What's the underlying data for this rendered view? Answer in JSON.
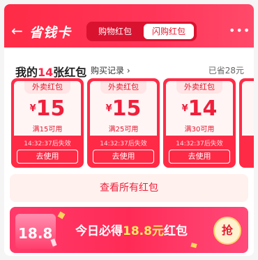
{
  "header": {
    "title": "省钱卡",
    "back_icon": "←",
    "tabs": [
      {
        "label": "购物红包",
        "active": false
      },
      {
        "label": "闪购红包",
        "active": true
      }
    ],
    "more_icon": "•••"
  },
  "section": {
    "title_prefix": "我的",
    "count": "14",
    "title_suffix": "张红包",
    "purchase_link": "购买记录 ›",
    "saved": "已省28元"
  },
  "coupons": [
    {
      "tag": "外卖红包",
      "currency": "¥",
      "amount": "15",
      "condition": "满15可用",
      "expiry": "14:32:37后失效",
      "action": "去使用"
    },
    {
      "tag": "外卖红包",
      "currency": "¥",
      "amount": "15",
      "condition": "满25可用",
      "expiry": "14:32:37后失效",
      "action": "去使用"
    },
    {
      "tag": "外卖红包",
      "currency": "¥",
      "amount": "14",
      "condition": "满30可用",
      "expiry": "14:32:37后失效",
      "action": "去使用"
    }
  ],
  "view_all": "查看所有红包",
  "banner": {
    "envelope_value": "18.8",
    "text_prefix": "今日必得",
    "text_highlight": "18.8元",
    "text_suffix": "红包",
    "grab_label": "抢"
  },
  "colors": {
    "brand_red": "#ff2b46",
    "accent_yellow": "#ffec5c"
  }
}
